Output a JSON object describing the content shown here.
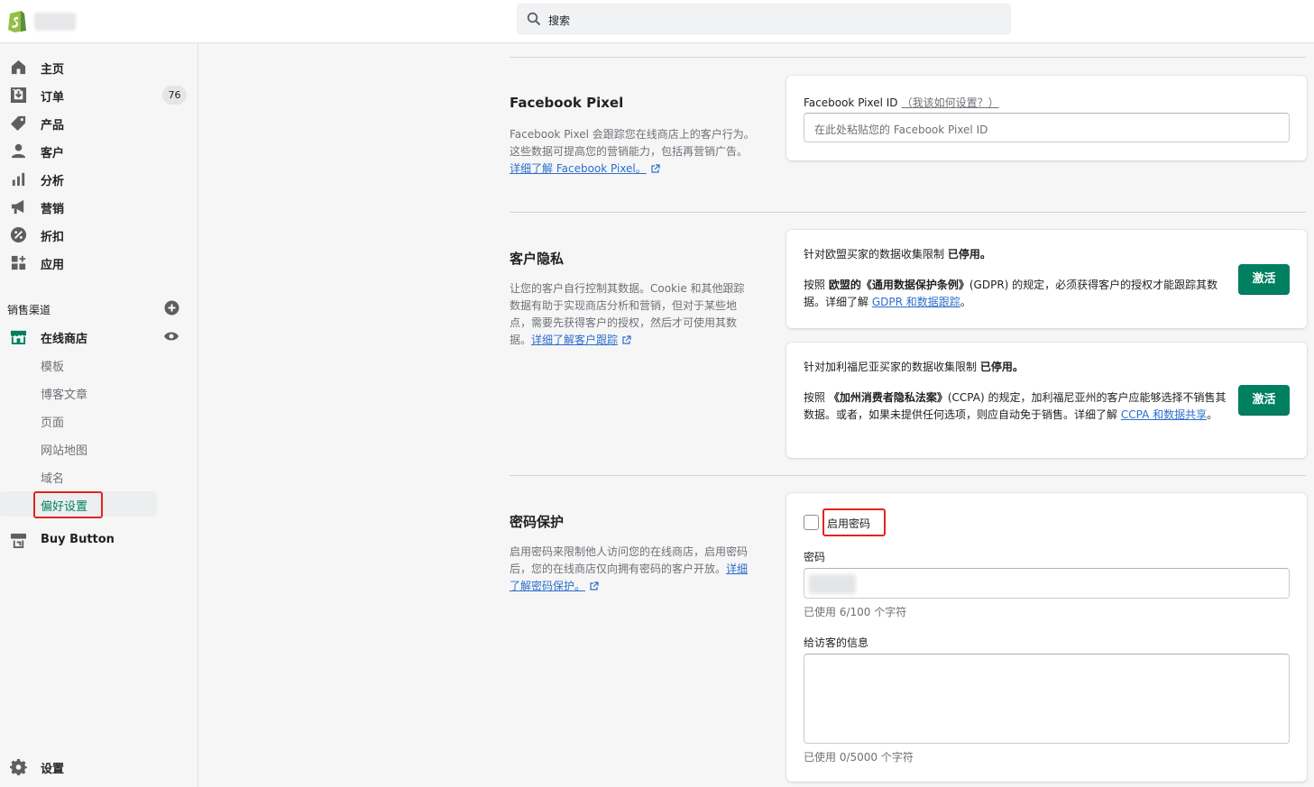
{
  "topbar": {
    "search_placeholder": "搜索"
  },
  "sidebar": {
    "items": [
      {
        "label": "主页",
        "icon": "home-icon"
      },
      {
        "label": "订单",
        "icon": "orders-icon",
        "badge": "76"
      },
      {
        "label": "产品",
        "icon": "tag-icon"
      },
      {
        "label": "客户",
        "icon": "person-icon"
      },
      {
        "label": "分析",
        "icon": "bar-chart-icon"
      },
      {
        "label": "营销",
        "icon": "megaphone-icon"
      },
      {
        "label": "折扣",
        "icon": "discount-icon"
      },
      {
        "label": "应用",
        "icon": "apps-icon"
      }
    ],
    "channels_label": "销售渠道",
    "online_store": "在线商店",
    "sub_items": [
      "模板",
      "博客文章",
      "页面",
      "网站地图",
      "域名",
      "偏好设置"
    ],
    "buy_button": "Buy Button",
    "settings": "设置"
  },
  "facebook": {
    "title": "Facebook Pixel",
    "desc": "Facebook Pixel 会跟踪您在线商店上的客户行为。这些数据可提高您的营销能力，包括再营销广告。",
    "desc_link": "详细了解 Facebook Pixel。",
    "field_label": "Facebook Pixel ID",
    "field_link": "（我该如何设置？）",
    "placeholder": "在此处粘贴您的 Facebook Pixel ID"
  },
  "privacy": {
    "title": "客户隐私",
    "desc": "让您的客户自行控制其数据。Cookie 和其他跟踪数据有助于实现商店分析和营销，但对于某些地点，需要先获得客户的授权，然后才可使用其数据。",
    "desc_link": "详细了解客户跟踪",
    "gdpr_heading": "针对欧盟买家的数据收集限制",
    "gdpr_status": "已停用。",
    "gdpr_body_1": "按照",
    "gdpr_body_bold": "欧盟的《通用数据保护条例》",
    "gdpr_body_2": "(GDPR) 的规定，必须获得客户的授权才能跟踪其数据。详细了解",
    "gdpr_link": "GDPR 和数据跟踪",
    "gdpr_end": "。",
    "ccpa_heading": "针对加利福尼亚买家的数据收集限制",
    "ccpa_status": "已停用。",
    "ccpa_body_1": "按照",
    "ccpa_body_bold": "《加州消费者隐私法案》",
    "ccpa_body_2": "(CCPA) 的规定，加利福尼亚州的客户应能够选择不销售其数据。或者，如果未提供任何选项，则应自动免于销售。详细了解",
    "ccpa_link": "CCPA 和数据共享",
    "ccpa_end": "。",
    "activate_label": "激活"
  },
  "password": {
    "title": "密码保护",
    "desc": "启用密码来限制他人访问您的在线商店，启用密码后，您的在线商店仅向拥有密码的客户开放。",
    "desc_link": "详细了解密码保护。",
    "enable_label": "启用密码",
    "password_label": "密码",
    "password_help": "已使用 6/100 个字符",
    "message_label": "给访客的信息",
    "message_help": "已使用 0/5000 个字符"
  },
  "colors": {
    "accent": "#008060",
    "link": "#2c6ecb",
    "highlight": "#e1251b"
  }
}
